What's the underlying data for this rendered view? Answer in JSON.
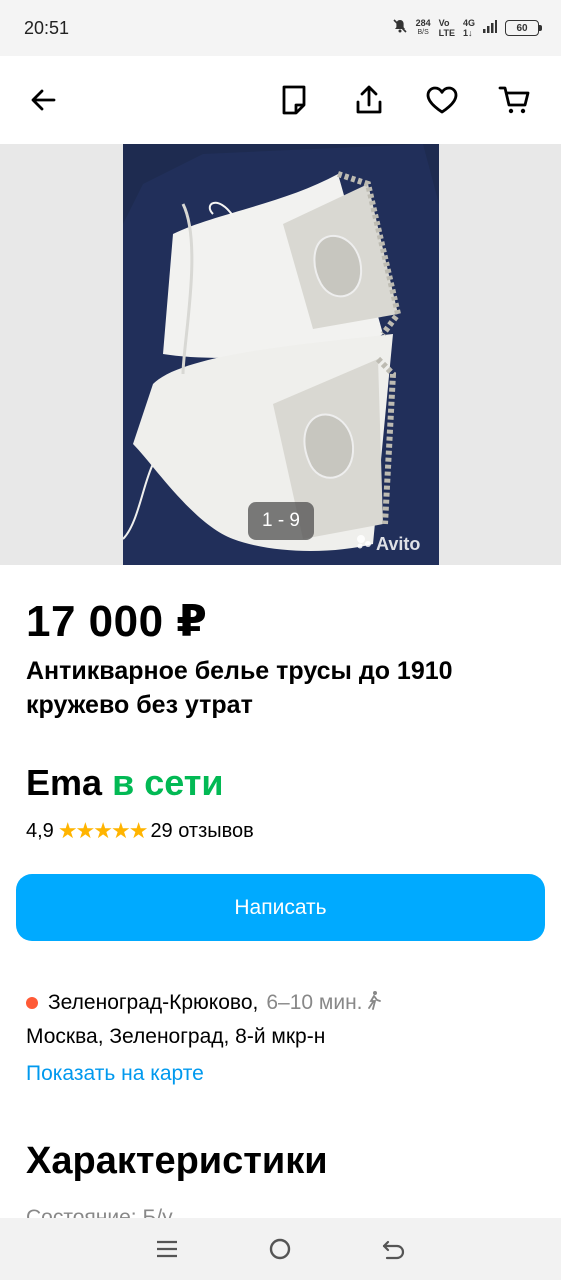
{
  "status_bar": {
    "time": "20:51",
    "net_speed_value": "284",
    "net_speed_unit": "B/S",
    "volte_top": "Vo",
    "volte_bottom": "LTE",
    "network_top": "4G",
    "network_bottom": "1↓",
    "battery": "60"
  },
  "toolbar": {
    "icons": [
      "back-arrow-icon",
      "note-icon",
      "share-icon",
      "heart-icon",
      "cart-icon"
    ]
  },
  "gallery": {
    "counter": "1 - 9",
    "watermark": "Avito"
  },
  "listing": {
    "price": "17 000 ₽",
    "title": "Антикварное белье трусы до 1910 кружево без утрат"
  },
  "seller": {
    "name": "Ema",
    "status": "в сети",
    "rating": "4,9",
    "stars": "★★★★★",
    "reviews": "29 отзывов",
    "write_label": "Написать"
  },
  "location": {
    "metro": "Зеленоград-Крюково,",
    "walk_time": "6–10 мин.",
    "address": "Москва, Зеленоград, 8-й мкр-н",
    "map_link": "Показать на карте"
  },
  "characteristics": {
    "title": "Характеристики",
    "first_row_partial": "Состояние: Б/у"
  },
  "colors": {
    "accent": "#00aaff",
    "online": "#02b954",
    "star": "#ffb400",
    "metro": "#ff5a36",
    "link": "#0099ee"
  }
}
